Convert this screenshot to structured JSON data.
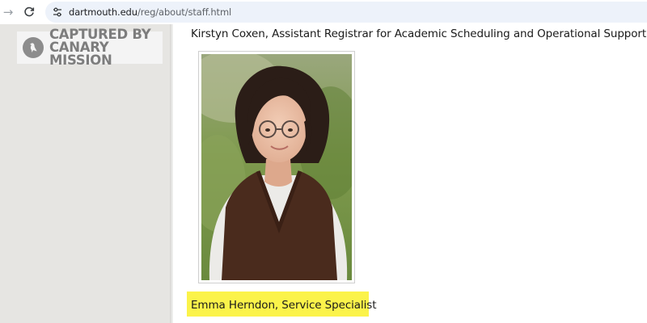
{
  "browser": {
    "url_domain": "dartmouth.edu",
    "url_path": "/reg/about/staff.html",
    "icons": [
      "forward-arrow-icon",
      "reload-icon",
      "site-info-icon"
    ]
  },
  "watermark": {
    "line1": "CAPTURED BY",
    "line2": "CANARY MISSION"
  },
  "content": {
    "previous_staff": "Kirstyn Coxen, Assistant Registrar for Academic Scheduling and Operational Support",
    "staff_caption": "Emma Herndon, Service Specialist",
    "highlight_color": "#fbf34a"
  }
}
